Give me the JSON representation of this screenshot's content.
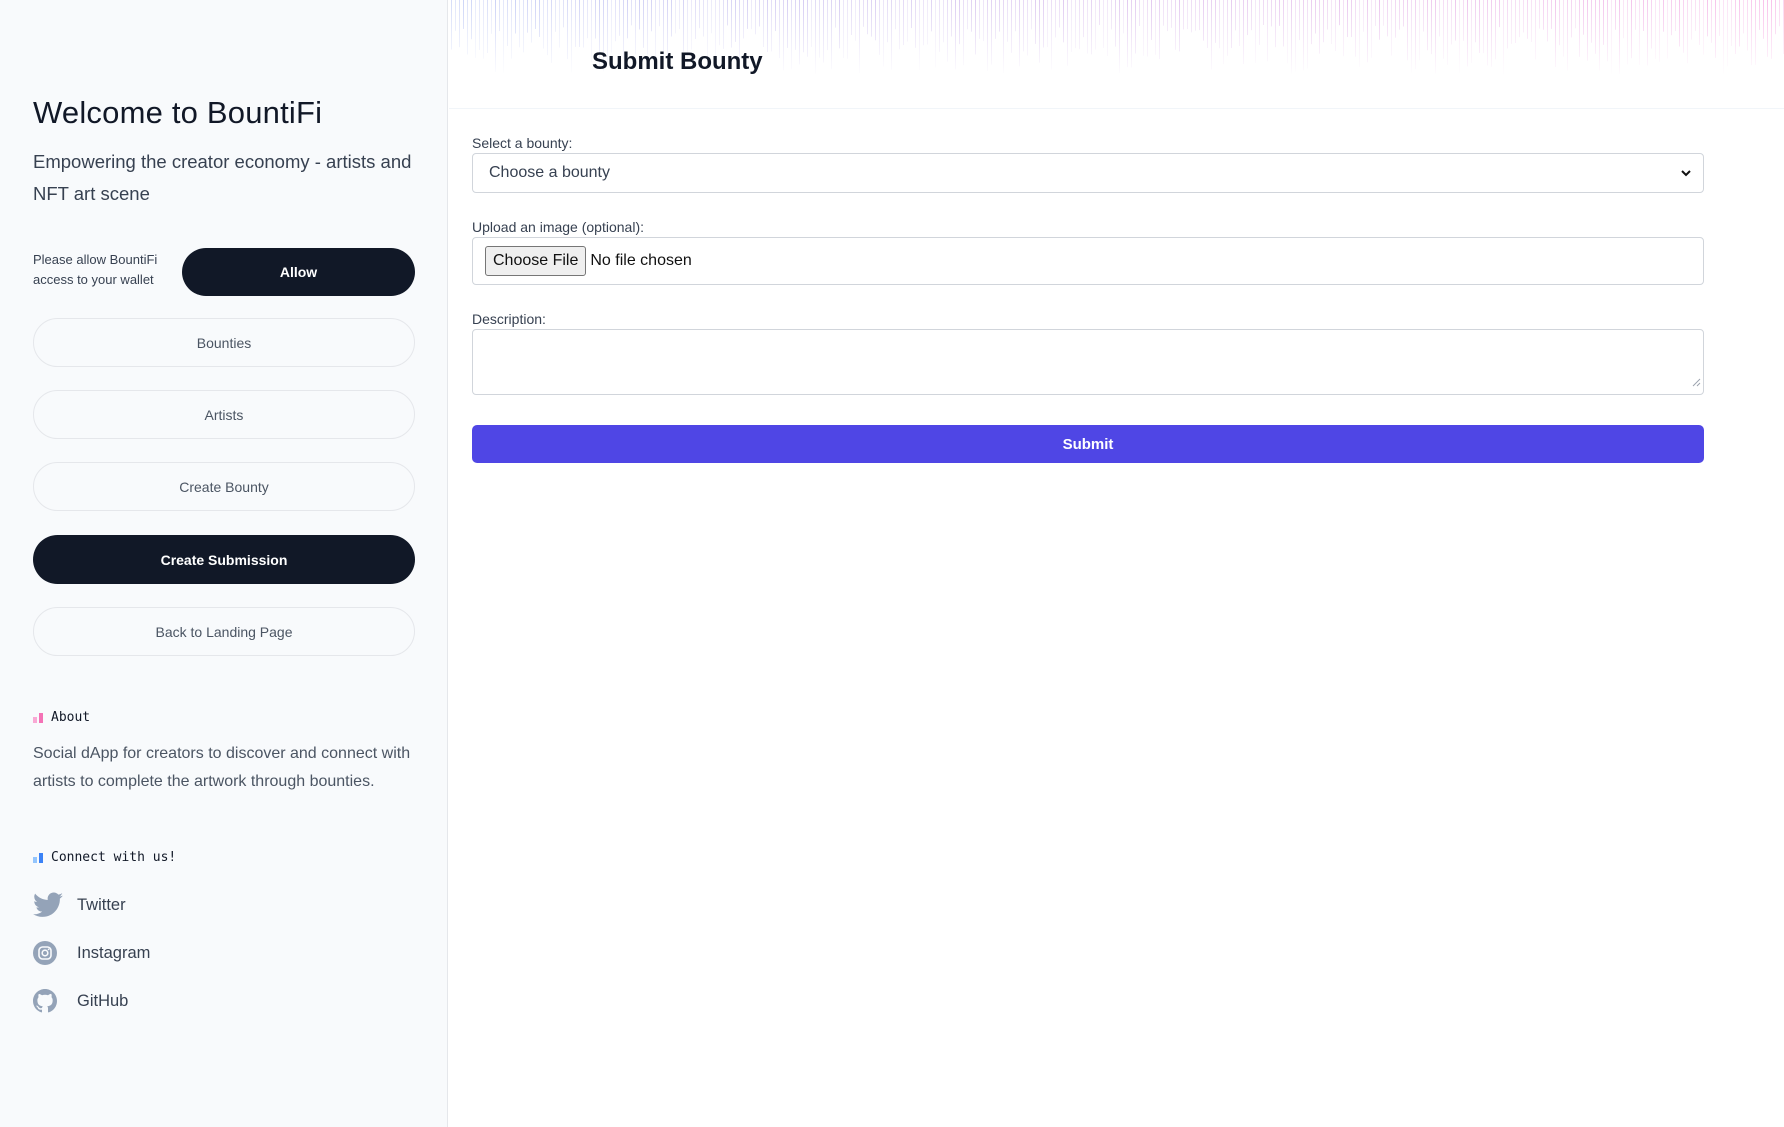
{
  "sidebar": {
    "welcome_title": "Welcome to BountiFi",
    "tagline": "Empowering the creator economy - artists and NFT art scene",
    "wallet_prompt": "Please allow BountiFi access to your wallet",
    "allow_label": "Allow",
    "nav": [
      {
        "label": "Bounties",
        "active": false
      },
      {
        "label": "Artists",
        "active": false
      },
      {
        "label": "Create Bounty",
        "active": false
      },
      {
        "label": "Create Submission",
        "active": true
      },
      {
        "label": "Back to Landing Page",
        "active": false
      }
    ],
    "about_heading": "About",
    "about_text": "Social dApp for creators to discover and connect with artists to complete the artwork through bounties.",
    "connect_heading": "Connect with us!",
    "social": [
      {
        "label": "Twitter",
        "icon": "twitter-icon"
      },
      {
        "label": "Instagram",
        "icon": "instagram-icon"
      },
      {
        "label": "GitHub",
        "icon": "github-icon"
      }
    ]
  },
  "main": {
    "title": "Submit Bounty",
    "form": {
      "bounty_label": "Select a bounty:",
      "bounty_value": "Choose a bounty",
      "image_label": "Upload an image (optional):",
      "file_button": "Choose File",
      "file_status": "No file chosen",
      "description_label": "Description:",
      "description_value": "",
      "submit_label": "Submit"
    }
  },
  "colors": {
    "accent": "#4f46e5",
    "dark": "#111827",
    "sidebar_bg": "#f8fafc",
    "about_bars": [
      "#f9a8d4",
      "#f472b6"
    ],
    "connect_bars": [
      "#93c5fd",
      "#3b82f6"
    ]
  }
}
